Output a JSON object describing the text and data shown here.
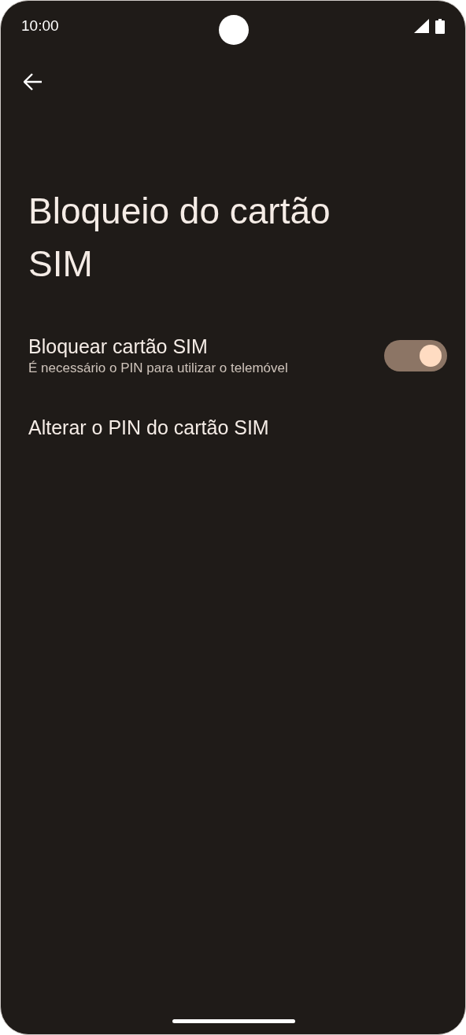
{
  "status_bar": {
    "time": "10:00"
  },
  "title": "Bloqueio do cartão SIM",
  "items": [
    {
      "kind": "switch",
      "title": "Bloquear cartão SIM",
      "summary": "É necessário o PIN para utilizar o telemóvel",
      "on": true
    },
    {
      "kind": "link",
      "title": "Alterar o PIN do cartão SIM"
    }
  ]
}
